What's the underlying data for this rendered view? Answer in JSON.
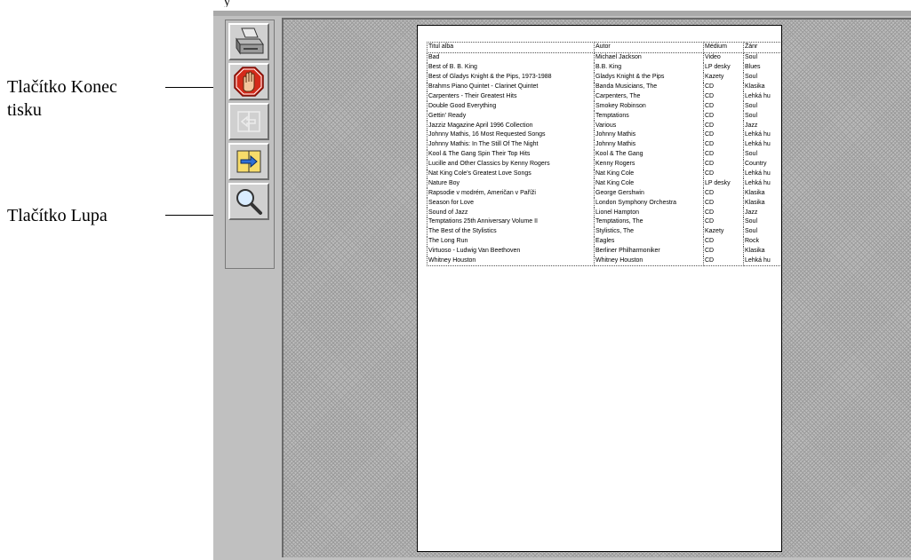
{
  "callouts": {
    "konec_label_line1": "Tlačítko Konec",
    "konec_label_line2": "tisku",
    "lupa_label": "Tlačítko Lupa",
    "top_fragment": "y"
  },
  "toolbar": {
    "buttons": [
      {
        "name": "print",
        "icon": "printer-icon"
      },
      {
        "name": "stop",
        "icon": "stop-hand-icon"
      },
      {
        "name": "back",
        "icon": "book-back-icon",
        "disabled": true
      },
      {
        "name": "forward",
        "icon": "book-forward-icon"
      },
      {
        "name": "zoom",
        "icon": "magnifier-icon"
      }
    ]
  },
  "report": {
    "columns": [
      "Titul alba",
      "Autor",
      "Médium",
      "Žánr"
    ],
    "rows": [
      [
        "Bad",
        "Michael Jackson",
        "Video",
        "Soul"
      ],
      [
        "Best of B. B. King",
        "B.B. King",
        "LP desky",
        "Blues"
      ],
      [
        "Best of Gladys Knight & the Pips, 1973-1988",
        "Gladys Knight & the Pips",
        "Kazety",
        "Soul"
      ],
      [
        "Brahms Piano Quintet - Clarinet Quintet",
        "Banda Musicians, The",
        "CD",
        "Klasika"
      ],
      [
        "Carpenters - Their Greatest Hits",
        "Carpenters, The",
        "CD",
        "Lehká hu"
      ],
      [
        "Double Good Everything",
        "Smokey Robinson",
        "CD",
        "Soul"
      ],
      [
        "Gettin' Ready",
        "Temptations",
        "CD",
        "Soul"
      ],
      [
        "Jazziz Magazine April 1996 Collection",
        "Various",
        "CD",
        "Jazz"
      ],
      [
        "Johnny Mathis, 16 Most Requested Songs",
        "Johnny Mathis",
        "CD",
        "Lehká hu"
      ],
      [
        "Johnny Mathis: In The Still Of The Night",
        "Johnny Mathis",
        "CD",
        "Lehká hu"
      ],
      [
        "Kool & The Gang Spin Their Top Hits",
        "Kool & The Gang",
        "CD",
        "Soul"
      ],
      [
        "Lucille and Other Classics by Kenny Rogers",
        "Kenny Rogers",
        "CD",
        "Country"
      ],
      [
        "Nat King Cole's Greatest Love Songs",
        "Nat King Cole",
        "CD",
        "Lehká hu"
      ],
      [
        "Nature Boy",
        "Nat King Cole",
        "LP desky",
        "Lehká hu"
      ],
      [
        "Rapsodie v modrém, Američan v Paříži",
        "George Gershwin",
        "CD",
        "Klasika"
      ],
      [
        "Season for Love",
        "London Symphony Orchestra",
        "CD",
        "Klasika"
      ],
      [
        "Sound of Jazz",
        "Lionel Hampton",
        "CD",
        "Jazz"
      ],
      [
        "Temptations 25th Anniversary Volume II",
        "Temptations, The",
        "CD",
        "Soul"
      ],
      [
        "The Best of the Stylistics",
        "Stylistics, The",
        "Kazety",
        "Soul"
      ],
      [
        "The Long Run",
        "Eagles",
        "CD",
        "Rock"
      ],
      [
        "Virtuoso - Ludwig Van Beethoven",
        "Berliner Philharmoniker",
        "CD",
        "Klasika"
      ],
      [
        "Whitney Houston",
        "Whitney Houston",
        "CD",
        "Lehká hu"
      ]
    ]
  }
}
